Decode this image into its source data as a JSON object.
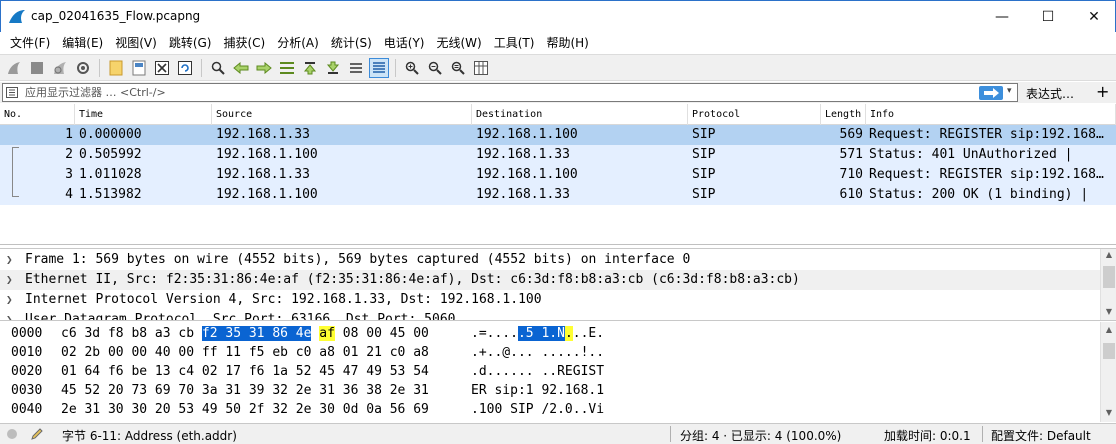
{
  "window": {
    "title": "cap_02041635_Flow.pcapng",
    "min_glyph": "—",
    "max_glyph": "☐",
    "close_glyph": "✕"
  },
  "menu": [
    "文件(F)",
    "编辑(E)",
    "视图(V)",
    "跳转(G)",
    "捕获(C)",
    "分析(A)",
    "统计(S)",
    "电话(Y)",
    "无线(W)",
    "工具(T)",
    "帮助(H)"
  ],
  "toolbar": {
    "icons": [
      "shark-fin-start-icon",
      "stop-square-icon",
      "restart-fin-icon",
      "capture-options-gear-icon",
      "open-folder-icon",
      "save-file-icon",
      "close-file-icon",
      "reload-icon",
      "find-magnifier-icon",
      "go-back-arrow-icon",
      "go-forward-arrow-icon",
      "go-to-packet-icon",
      "go-first-icon",
      "go-last-icon",
      "autoscroll-icon",
      "colorize-icon",
      "zoom-in-icon",
      "zoom-out-icon",
      "zoom-normal-icon",
      "resize-columns-icon"
    ]
  },
  "filter": {
    "placeholder": "应用显示过滤器 … <Ctrl-/>",
    "expression_label": "表达式…",
    "plus": "+",
    "dropdown": "▾"
  },
  "packet_list": {
    "columns": [
      "No.",
      "Time",
      "Source",
      "Destination",
      "Protocol",
      "Length",
      "Info"
    ],
    "rows": [
      {
        "no": "1",
        "time": "0.000000",
        "source": "192.168.1.33",
        "destination": "192.168.1.100",
        "protocol": "SIP",
        "length": "569",
        "info": "Request: REGISTER sip:192.168…"
      },
      {
        "no": "2",
        "time": "0.505992",
        "source": "192.168.1.100",
        "destination": "192.168.1.33",
        "protocol": "SIP",
        "length": "571",
        "info": "Status: 401 UnAuthorized |"
      },
      {
        "no": "3",
        "time": "1.011028",
        "source": "192.168.1.33",
        "destination": "192.168.1.100",
        "protocol": "SIP",
        "length": "710",
        "info": "Request: REGISTER sip:192.168…"
      },
      {
        "no": "4",
        "time": "1.513982",
        "source": "192.168.1.100",
        "destination": "192.168.1.33",
        "protocol": "SIP",
        "length": "610",
        "info": "Status: 200 OK  (1 binding) |"
      }
    ]
  },
  "detail": {
    "rows": [
      "Frame 1: 569 bytes on wire (4552 bits), 569 bytes captured (4552 bits) on interface 0",
      "Ethernet II, Src: f2:35:31:86:4e:af (f2:35:31:86:4e:af), Dst: c6:3d:f8:b8:a3:cb (c6:3d:f8:b8:a3:cb)",
      "Internet Protocol Version 4, Src: 192.168.1.33, Dst: 192.168.1.100",
      "User Datagram Protocol, Src Port: 63166, Dst Port: 5060"
    ]
  },
  "hex": {
    "rows": [
      {
        "offset": "0000",
        "b1": "c6 3d f8 b8 a3 cb ",
        "b2": "f2 35  31 86 4e",
        "b3": " ",
        "b4": "af",
        "b5": " 08 00 45 00",
        "a1": ".=....",
        "a2": ".5 1.N",
        "a3": ".",
        "a4": "..E."
      },
      {
        "offset": "0010",
        "b1": "02 2b 00 00 40 00 ff 11  f5 eb c0 a8 01 21 c0 a8",
        "a1": ".+..@... .....!.."
      },
      {
        "offset": "0020",
        "b1": "01 64 f6 be 13 c4 02 17  f6 1a 52 45 47 49 53 54",
        "a1": ".d...... ..REGIST"
      },
      {
        "offset": "0030",
        "b1": "45 52 20 73 69 70 3a 31  39 32 2e 31 36 38 2e 31",
        "a1": "ER sip:1 92.168.1"
      },
      {
        "offset": "0040",
        "b1": "2e 31 30 30 20 53 49 50  2f 32 2e 30 0d 0a 56 69",
        "a1": ".100 SIP /2.0..Vi"
      }
    ]
  },
  "status": {
    "field": "字节 6-11: Address (eth.addr)",
    "packets": "分组: 4 · 已显示: 4 (100.0%)",
    "load_time": "加载时间: 0:0.1",
    "profile": "配置文件: Default"
  },
  "colors": {
    "selected_row": "#b3d2f2",
    "row_bg": "#e4efff",
    "hex_highlight": "#0a64d2",
    "hex_yellow": "#ffff33"
  }
}
